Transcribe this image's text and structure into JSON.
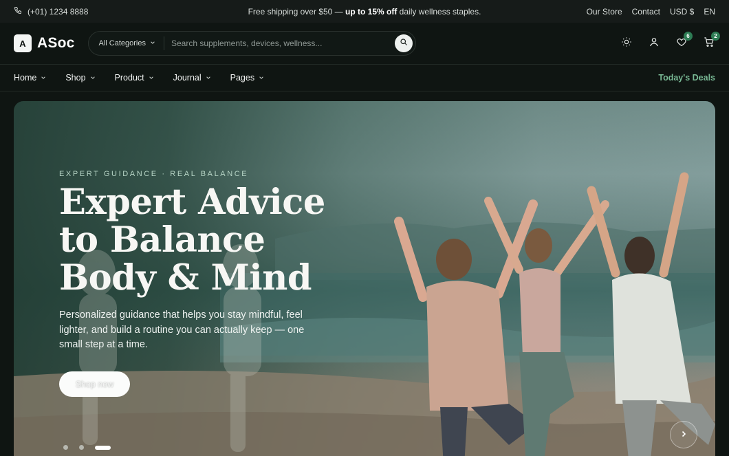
{
  "topbar": {
    "phone": "(+01) 1234 8888",
    "promo_prefix": "Free shipping over $50 — ",
    "promo_bold": "up to 15% off",
    "promo_suffix": " daily wellness staples.",
    "links": [
      "Our Store",
      "Contact",
      "USD $",
      "EN"
    ]
  },
  "header": {
    "logo_mark": "A",
    "logo_text": "ASoc",
    "category": "All Categories",
    "search_placeholder": "Search supplements, devices, wellness...",
    "wishlist_count": "6",
    "cart_count": "2"
  },
  "nav": {
    "items": [
      "Home",
      "Shop",
      "Product",
      "Journal",
      "Pages"
    ],
    "deals": "Today's Deals"
  },
  "hero": {
    "eyebrow": "EXPERT GUIDANCE · REAL BALANCE",
    "title_line1": "Expert Advice",
    "title_line2": "to Balance",
    "title_line3": "Body & Mind",
    "subtitle": "Personalized guidance that helps you stay mindful, feel lighter, and build a routine you can actually keep — one small step at a time.",
    "cta": "Shop now",
    "active_slide": 3,
    "slide_count": 3
  },
  "colors": {
    "page_bg": "#0f1512",
    "accent_green": "#78b894",
    "badge_green": "#2e7d55"
  }
}
